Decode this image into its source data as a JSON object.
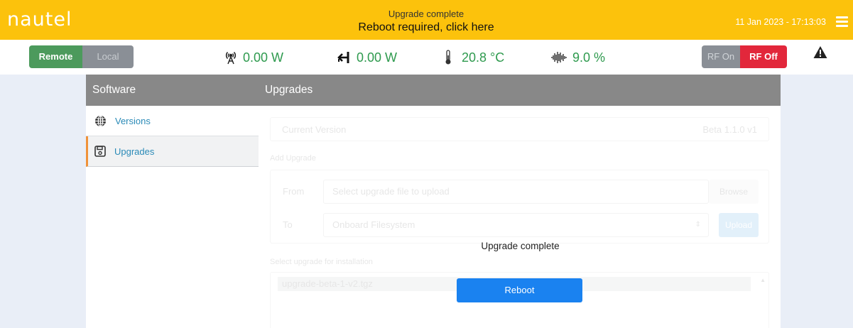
{
  "header": {
    "logo": "nautel",
    "banner_line1": "Upgrade complete",
    "banner_line2": "Reboot required, click here",
    "datetime": "11 Jan 2023 - 17:13:03"
  },
  "status": {
    "remote_label": "Remote",
    "local_label": "Local",
    "forward_power": "0.00 W",
    "reflected_power": "0.00 W",
    "temperature": "20.8 °C",
    "modulation": "9.0 %",
    "rf_on_label": "RF On",
    "rf_off_label": "RF Off"
  },
  "sidebar": {
    "title": "Software",
    "items": [
      {
        "label": "Versions",
        "icon": "globe-icon"
      },
      {
        "label": "Upgrades",
        "icon": "save-icon"
      }
    ]
  },
  "main": {
    "title": "Upgrades",
    "current_version_label": "Current Version",
    "current_version_value": "Beta 1.1.0 v1",
    "add_upgrade_label": "Add Upgrade",
    "from_label": "From",
    "from_placeholder": "Select upgrade file to upload",
    "browse_label": "Browse",
    "to_label": "To",
    "to_value": "Onboard Filesystem",
    "upload_label": "Upload",
    "select_label": "Select upgrade for installation",
    "upgrade_files": [
      "upgrade-beta-1-v2.tgz"
    ]
  },
  "dialog": {
    "message": "Upgrade complete",
    "reboot_label": "Reboot"
  },
  "colors": {
    "banner": "#fcc20c",
    "remote_active": "#4c9a5c",
    "rf_off_active": "#e2273b",
    "reading_text": "#2e9a4e",
    "reboot_button": "#1a82f0"
  }
}
